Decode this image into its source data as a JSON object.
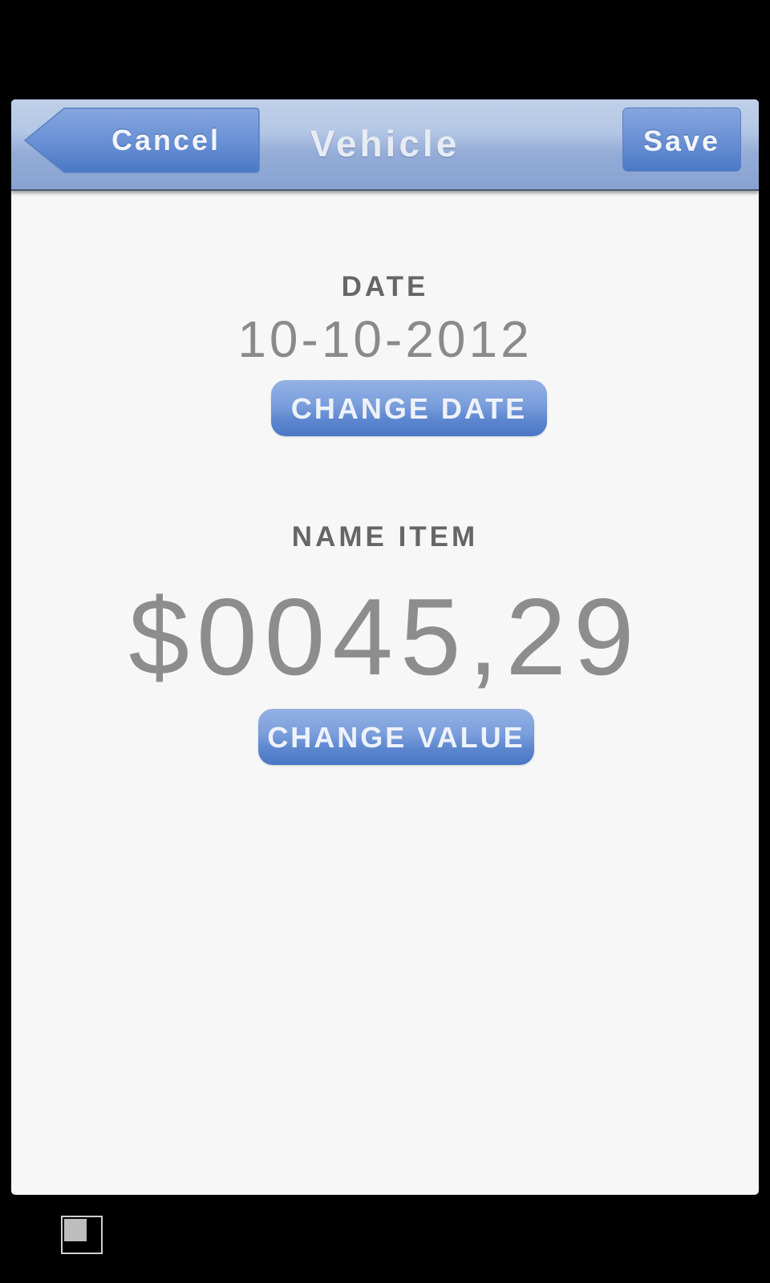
{
  "navbar": {
    "title": "Vehicle",
    "cancel_label": "Cancel",
    "save_label": "Save"
  },
  "date_section": {
    "label": "DATE",
    "value": "10-10-2012",
    "button_label": "CHANGE DATE"
  },
  "value_section": {
    "label": "NAME ITEM",
    "value": "$0045,29",
    "button_label": "CHANGE VALUE"
  },
  "colors": {
    "accent": "#4a77c6",
    "navbar": "#b4c7e5",
    "background": "#f7f7f7"
  },
  "icons": {
    "corner": "window-toggle-icon"
  }
}
